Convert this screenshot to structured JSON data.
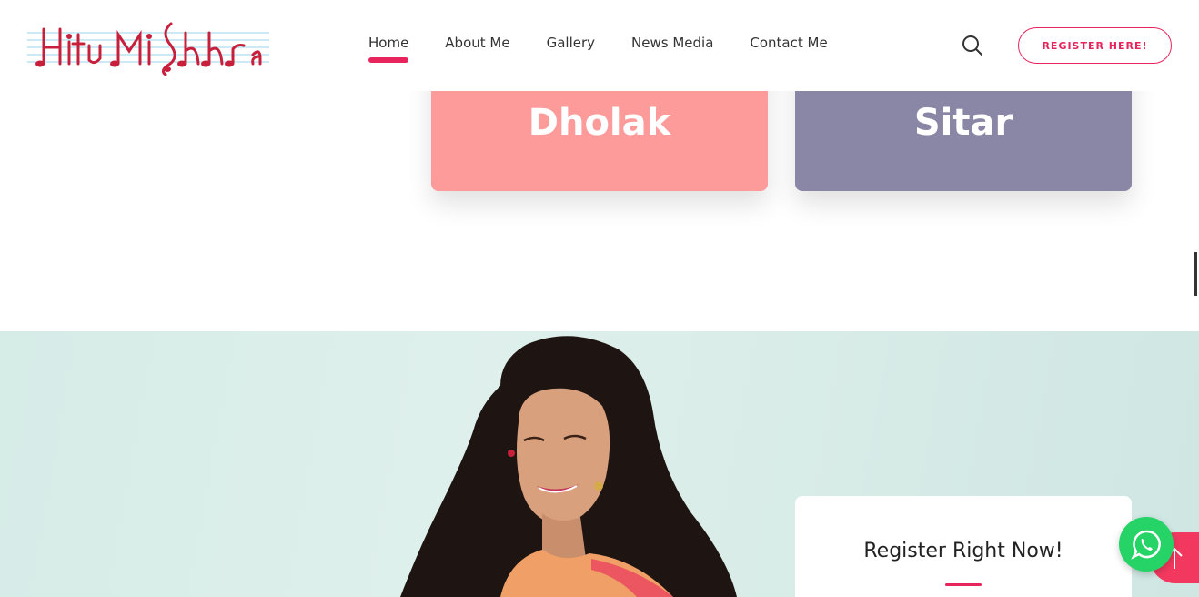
{
  "brand": {
    "logo_icon": "music-notes-logo",
    "accent_color": "#e8245c"
  },
  "nav": {
    "items": [
      {
        "label": "Home",
        "active": true
      },
      {
        "label": "About Me",
        "active": false
      },
      {
        "label": "Gallery",
        "active": false
      },
      {
        "label": "News Media",
        "active": false
      },
      {
        "label": "Contact Me",
        "active": false
      }
    ],
    "search_icon": "search-icon"
  },
  "header": {
    "register_label": "REGISTER HERE!"
  },
  "instruments": [
    {
      "title": "Dholak",
      "color": "#fd9a9a"
    },
    {
      "title": "Sitar",
      "color": "#8a86a6"
    }
  ],
  "register_panel": {
    "title": "Register Right Now!"
  },
  "floating": {
    "whatsapp_icon": "whatsapp-icon",
    "scroll_top_icon": "arrow-up-icon"
  }
}
